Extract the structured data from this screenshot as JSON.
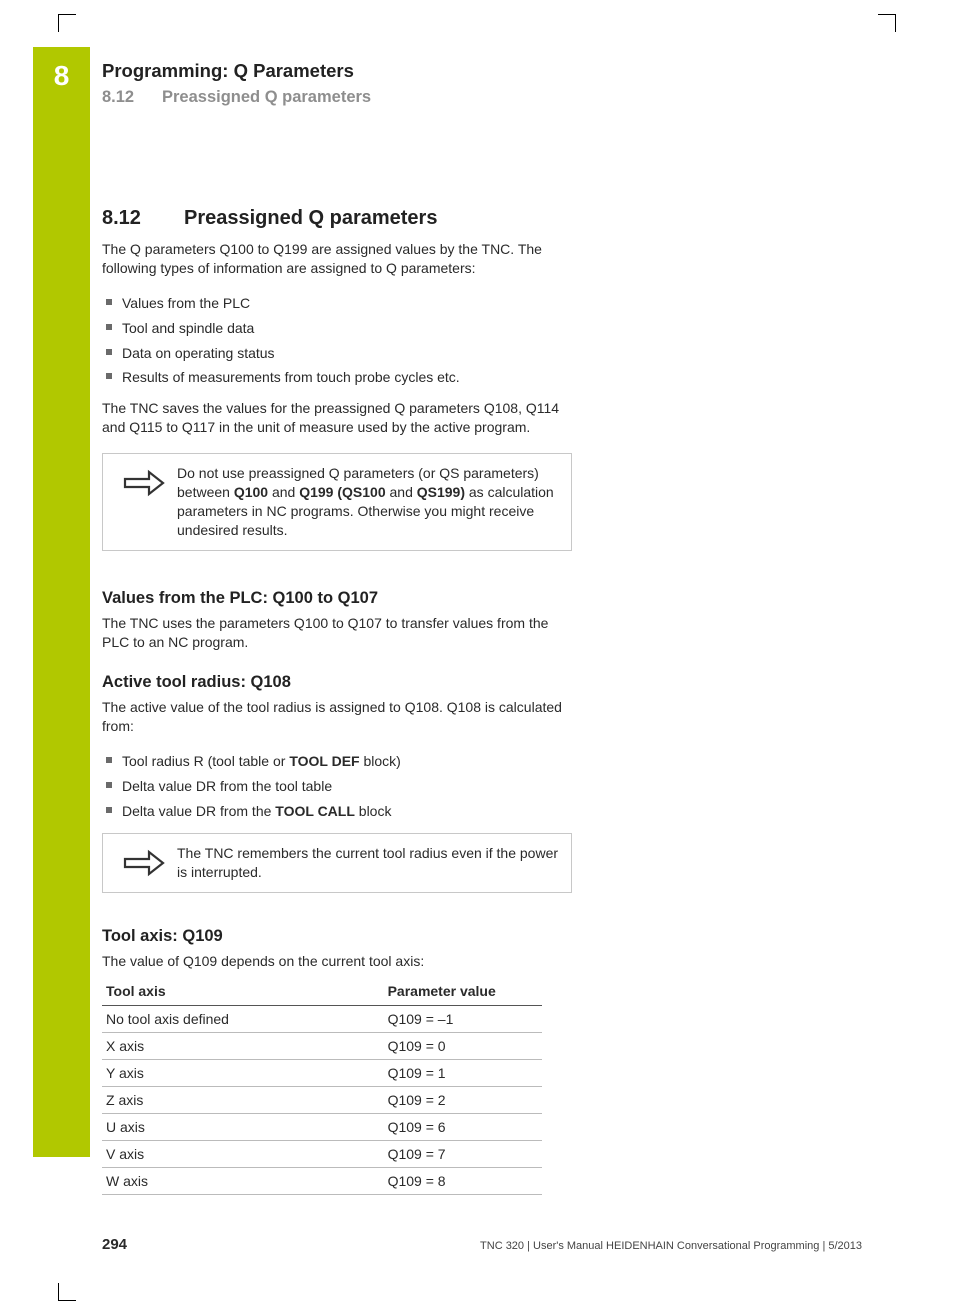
{
  "chapter": {
    "num": "8",
    "title": "Programming: Q Parameters"
  },
  "breadcrumb": {
    "num": "8.12",
    "title": "Preassigned Q parameters"
  },
  "sectionHeading": {
    "num": "8.12",
    "title": "Preassigned Q parameters"
  },
  "intro": {
    "p1": "The Q parameters Q100 to Q199 are assigned values by the TNC. The following types of information are assigned to Q parameters:",
    "bullets": [
      "Values from the PLC",
      "Tool and spindle data",
      "Data on operating status",
      "Results of measurements from touch probe cycles etc."
    ],
    "p2": "The TNC saves the values for the preassigned Q parameters Q108, Q114 and Q115 to Q117 in the unit of measure used by the active program."
  },
  "note1": {
    "pre": "Do not use preassigned Q parameters (or QS parameters) between ",
    "b1": "Q100",
    "mid1": " and ",
    "b2": "Q199 (QS100",
    "mid2": " and ",
    "b3": "QS199)",
    "post": " as calculation parameters in NC programs. Otherwise you might receive undesired results."
  },
  "sec1": {
    "heading": "Values from the PLC: Q100 to Q107",
    "p": "The TNC uses the parameters Q100 to Q107 to transfer values from the PLC to an NC program."
  },
  "sec2": {
    "heading": "Active tool radius: Q108",
    "p": "The active value of the tool radius is assigned to Q108. Q108 is calculated from:",
    "bullets": {
      "b1pre": "Tool radius R (tool table or ",
      "b1b": "TOOL DEF",
      "b1post": " block)",
      "b2": "Delta value DR from the tool table",
      "b3pre": "Delta value DR from the ",
      "b3b": "TOOL CALL",
      "b3post": " block"
    }
  },
  "note2": "The TNC remembers the current tool radius even if the power is interrupted.",
  "sec3": {
    "heading": "Tool axis: Q109",
    "p": "The value of Q109 depends on the current tool axis:",
    "thead": {
      "c1": "Tool axis",
      "c2": "Parameter value"
    },
    "rows": [
      {
        "c1": "No tool axis defined",
        "c2": "Q109 = –1"
      },
      {
        "c1": "X axis",
        "c2": "Q109 = 0"
      },
      {
        "c1": "Y axis",
        "c2": "Q109 = 1"
      },
      {
        "c1": "Z axis",
        "c2": "Q109 = 2"
      },
      {
        "c1": "U axis",
        "c2": "Q109 = 6"
      },
      {
        "c1": "V axis",
        "c2": "Q109 = 7"
      },
      {
        "c1": "W axis",
        "c2": "Q109 = 8"
      }
    ]
  },
  "footer": {
    "page": "294",
    "text": "TNC 320 | User's Manual HEIDENHAIN Conversational Programming | 5/2013"
  }
}
